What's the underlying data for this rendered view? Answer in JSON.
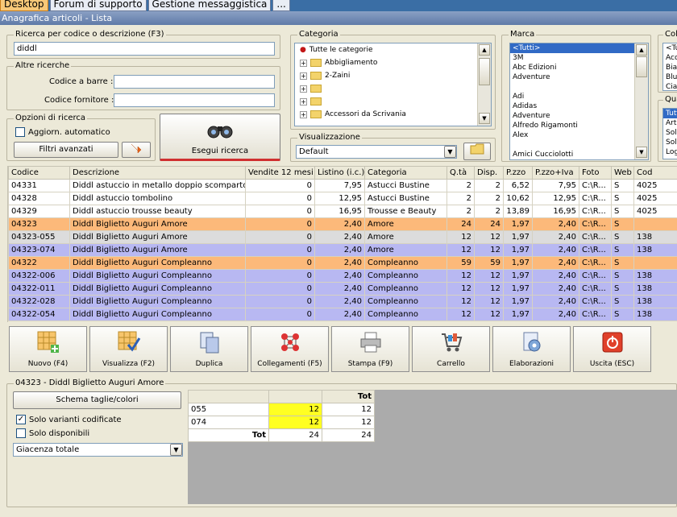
{
  "tabs": [
    "Desktop",
    "Forum di supporto",
    "Gestione messaggistica",
    "..."
  ],
  "window_title": "Anagrafica articoli  - Lista",
  "search": {
    "label": "Ricerca per codice o descrizione (F3)",
    "value": "diddl",
    "altre_label": "Altre ricerche",
    "barcode_label": "Codice a barre :",
    "fornitore_label": "Codice fornitore :",
    "opzioni_label": "Opzioni di ricerca",
    "auto_label": "Aggiorn. automatico",
    "filtri_label": "Filtri avanzati",
    "esegui_label": "Esegui ricerca"
  },
  "categoria": {
    "label": "Categoria",
    "items": [
      "Tutte le categorie",
      "Abbigliamento",
      "2-Zaini",
      "",
      "",
      "Accessori da Scrivania"
    ]
  },
  "visualizzazione": {
    "label": "Visualizzazione",
    "value": "Default"
  },
  "marca": {
    "label": "Marca",
    "items": [
      "<Tutti>",
      "3M",
      "Abc Edizioni",
      "Adventure",
      "",
      "Adi",
      "Adidas",
      "Adventure",
      "Alfredo Rigamonti",
      "Alex",
      "",
      "Amici Cucciolotti"
    ]
  },
  "colore": {
    "label": "Colo",
    "items": [
      "<Tutti>",
      "Acc",
      "Bian",
      "Blu",
      "Cial"
    ]
  },
  "qualita": {
    "label": "Qua",
    "items": [
      "Tutt",
      "Arti",
      "Sold",
      "Sold",
      "Logi"
    ]
  },
  "grid": {
    "headers": [
      "Codice",
      "Descrizione",
      "Vendite 12 mesi",
      "Listino (i.c.)",
      "Categoria",
      "Q.tà",
      "Disp.",
      "P.zzo",
      "P.zzo+Iva",
      "Foto",
      "Web",
      "Cod"
    ],
    "rows": [
      {
        "style": "white",
        "cells": [
          "04331",
          "Diddl astuccio in metallo doppio scomparto",
          "0",
          "7,95",
          "Astucci Bustine",
          "2",
          "2",
          "6,52",
          "7,95",
          "C:\\R...",
          "S",
          "4025"
        ]
      },
      {
        "style": "white",
        "cells": [
          "04328",
          "Diddl astuccio tombolino",
          "0",
          "12,95",
          "Astucci Bustine",
          "2",
          "2",
          "10,62",
          "12,95",
          "C:\\R...",
          "S",
          "4025"
        ]
      },
      {
        "style": "white",
        "cells": [
          "04329",
          "Diddl astuccio trousse beauty",
          "0",
          "16,95",
          "Trousse e Beauty",
          "2",
          "2",
          "13,89",
          "16,95",
          "C:\\R...",
          "S",
          "4025"
        ]
      },
      {
        "style": "orange",
        "cells": [
          "04323",
          "Diddl Biglietto Auguri Amore",
          "0",
          "2,40",
          "Amore",
          "24",
          "24",
          "1,97",
          "2,40",
          "C:\\R...",
          "S",
          ""
        ]
      },
      {
        "style": "grey",
        "cells": [
          "04323-055",
          "Diddl Biglietto Auguri Amore",
          "0",
          "2,40",
          "Amore",
          "12",
          "12",
          "1,97",
          "2,40",
          "C:\\R...",
          "S",
          "138"
        ]
      },
      {
        "style": "purple",
        "cells": [
          "04323-074",
          "Diddl Biglietto Auguri Amore",
          "0",
          "2,40",
          "Amore",
          "12",
          "12",
          "1,97",
          "2,40",
          "C:\\R...",
          "S",
          "138"
        ]
      },
      {
        "style": "orange",
        "cells": [
          "04322",
          "Diddl Biglietto Auguri Compleanno",
          "0",
          "2,40",
          "Compleanno",
          "59",
          "59",
          "1,97",
          "2,40",
          "C:\\R...",
          "S",
          ""
        ]
      },
      {
        "style": "purple",
        "cells": [
          "04322-006",
          "Diddl Biglietto Auguri Compleanno",
          "0",
          "2,40",
          "Compleanno",
          "12",
          "12",
          "1,97",
          "2,40",
          "C:\\R...",
          "S",
          "138"
        ]
      },
      {
        "style": "purple",
        "cells": [
          "04322-011",
          "Diddl Biglietto Auguri Compleanno",
          "0",
          "2,40",
          "Compleanno",
          "12",
          "12",
          "1,97",
          "2,40",
          "C:\\R...",
          "S",
          "138"
        ]
      },
      {
        "style": "purple",
        "cells": [
          "04322-028",
          "Diddl Biglietto Auguri Compleanno",
          "0",
          "2,40",
          "Compleanno",
          "12",
          "12",
          "1,97",
          "2,40",
          "C:\\R...",
          "S",
          "138"
        ]
      },
      {
        "style": "purple",
        "cells": [
          "04322-054",
          "Diddl Biglietto Auguri Compleanno",
          "0",
          "2,40",
          "Compleanno",
          "12",
          "12",
          "1,97",
          "2,40",
          "C:\\R...",
          "S",
          "138"
        ]
      }
    ]
  },
  "toolbar": {
    "nuovo": "Nuovo (F4)",
    "visualizza": "Visualizza (F2)",
    "duplica": "Duplica",
    "collegamenti": "Collegamenti (F5)",
    "stampa": "Stampa (F9)",
    "carrello": "Carrello",
    "elaborazioni": "Elaborazioni",
    "uscita": "Uscita (ESC)"
  },
  "detail": {
    "title": "04323 - Diddl Biglietto Auguri Amore",
    "schema_label": "Schema taglie/colori",
    "solo_varianti": "Solo varianti codificate",
    "solo_disponibili": "Solo disponibili",
    "giacenza": "Giacenza totale",
    "size_header": "Tot",
    "size_rows": [
      {
        "code": "055",
        "value": "12",
        "tot": "12"
      },
      {
        "code": "074",
        "value": "12",
        "tot": "12"
      }
    ],
    "size_total_label": "Tot",
    "size_total": "24",
    "size_total_tot": "24"
  },
  "colors": {
    "orange_row": "#fcb97a",
    "purple_row": "#b8b8f2",
    "grey_row": "#dcdcdc",
    "highlight": "#ffff22"
  }
}
